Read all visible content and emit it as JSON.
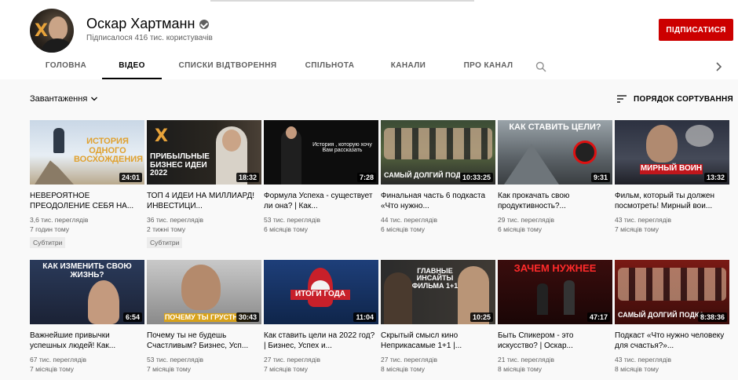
{
  "channel": {
    "name": "Оскар Хартманн",
    "subscribers": "Підписалося 416 тис. користувачів",
    "subscribe_label": "ПІДПИСАТИСЯ"
  },
  "tabs": [
    {
      "label": "ГОЛОВНА"
    },
    {
      "label": "ВІДЕО"
    },
    {
      "label": "СПИСКИ ВІДТВОРЕННЯ"
    },
    {
      "label": "СПІЛЬНОТА"
    },
    {
      "label": "КАНАЛИ"
    },
    {
      "label": "ПРО КАНАЛ"
    }
  ],
  "toolbar": {
    "uploads_label": "Завантаження",
    "sort_label": "ПОРЯДОК СОРТУВАННЯ"
  },
  "videos": [
    {
      "title": "НЕВЕРОЯТНОЕ ПРЕОДОЛЕНИЕ СЕБЯ НА...",
      "views": "3,6 тис. переглядів",
      "age": "7 годин тому",
      "duration": "24:01",
      "badge": "Субтитри",
      "thumb_text": "ИСТОРИЯ ОДНОГО ВОСХОЖДЕНИЯ"
    },
    {
      "title": "ТОП 4 ИДЕИ НА МИЛЛИАРД! ИНВЕСТИЦИ...",
      "views": "36 тис. переглядів",
      "age": "2 тижні тому",
      "duration": "18:32",
      "badge": "Субтитри",
      "thumb_text": "ПРИБЫЛЬНЫЕ БИЗНЕС ИДЕИ 2022"
    },
    {
      "title": "Формула Успеха - существует ли она? | Как...",
      "views": "53 тис. переглядів",
      "age": "6 місяців тому",
      "duration": "7:28",
      "badge": "",
      "thumb_text": "История , которую хочу Вам рассказать"
    },
    {
      "title": "Финальная часть 6 подкаста «Что нужно...",
      "views": "44 тис. переглядів",
      "age": "6 місяців тому",
      "duration": "10:33:25",
      "badge": "",
      "thumb_text": "САМЫЙ ДОЛГИЙ ПОД"
    },
    {
      "title": "Как прокачать свою продуктивность?...",
      "views": "29 тис. переглядів",
      "age": "6 місяців тому",
      "duration": "9:31",
      "badge": "",
      "thumb_text": "КАК СТАВИТЬ ЦЕЛИ?"
    },
    {
      "title": "Фильм, который ты должен посмотреть! Мирный вои...",
      "views": "43 тис. переглядів",
      "age": "7 місяців тому",
      "duration": "13:32",
      "badge": "",
      "thumb_text": "МИРНЫЙ ВОИН"
    },
    {
      "title": "Важнейшие привычки успешных людей! Как...",
      "views": "67 тис. переглядів",
      "age": "7 місяців тому",
      "duration": "6:54",
      "badge": "",
      "thumb_text": "КАК ИЗМЕНИТЬ СВОЮ ЖИЗНЬ?"
    },
    {
      "title": "Почему ты не будешь Счастливым? Бизнес, Усп...",
      "views": "53 тис. переглядів",
      "age": "7 місяців тому",
      "duration": "30:43",
      "badge": "",
      "thumb_text": "ПОЧЕМУ ТЫ ГРУСТНЫЙ"
    },
    {
      "title": "Как ставить цели на 2022 год? | Бизнес, Успех и...",
      "views": "27 тис. переглядів",
      "age": "7 місяців тому",
      "duration": "11:04",
      "badge": "",
      "thumb_text": "ИТОГИ ГОДА"
    },
    {
      "title": "Скрытый смысл кино Неприкасамые 1+1 |...",
      "views": "27 тис. переглядів",
      "age": "8 місяців тому",
      "duration": "10:25",
      "badge": "",
      "thumb_text": "ГЛАВНЫЕ ИНСАЙТЫ ФИЛЬМА 1+1"
    },
    {
      "title": "Быть Спикером - это искусство? | Оскар...",
      "views": "21 тис. переглядів",
      "age": "8 місяців тому",
      "duration": "47:17",
      "badge": "",
      "thumb_text": "ЗАЧЕМ НУЖНЕЕ"
    },
    {
      "title": "Подкаст «Что нужно человеку для счастья?»...",
      "views": "43 тис. переглядів",
      "age": "8 місяців тому",
      "duration": "8:38:36",
      "badge": "",
      "thumb_text": "САМЫЙ ДОЛГИЙ ПОДКА"
    }
  ],
  "colors": {
    "accent": "#cc0000",
    "text": "#030303",
    "secondary": "#606060",
    "background": "#f9f9f9"
  }
}
